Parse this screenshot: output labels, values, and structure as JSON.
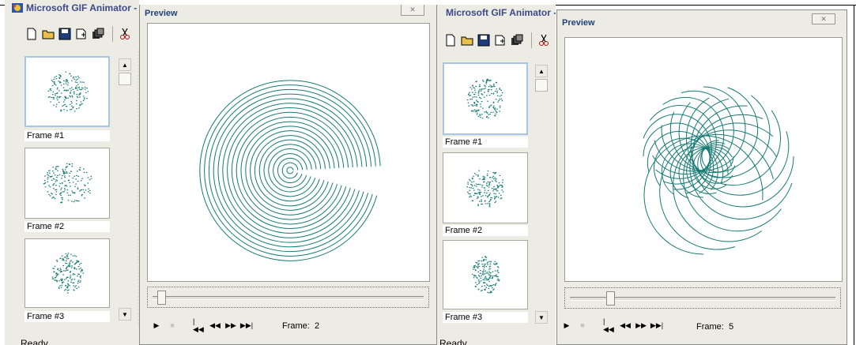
{
  "left_app": {
    "title": "Microsoft GIF Animator -",
    "frames": [
      {
        "label": "Frame #1",
        "selected": true
      },
      {
        "label": "Frame #2",
        "selected": false
      },
      {
        "label": "Frame #3",
        "selected": false
      }
    ],
    "status": "Ready"
  },
  "left_preview": {
    "title": "Preview",
    "close": "✕",
    "frame_label": "Frame:",
    "frame_value": "2"
  },
  "right_app": {
    "title": "Microsoft GIF Animator -",
    "frames": [
      {
        "label": "Frame #1",
        "selected": true
      },
      {
        "label": "Frame #2",
        "selected": false
      },
      {
        "label": "Frame #3",
        "selected": false
      }
    ],
    "status": "Ready"
  },
  "right_preview": {
    "title": "Preview",
    "close": "✕",
    "frame_label": "Frame:",
    "frame_value": "5"
  },
  "toolbar_icons": [
    "new-file-icon",
    "open-folder-icon",
    "save-icon",
    "insert-icon",
    "properties-icon",
    "cut-icon"
  ],
  "controls": [
    "play-icon",
    "stop-icon",
    "first-frame-icon",
    "previous-frame-icon",
    "next-frame-icon",
    "last-frame-icon"
  ],
  "colors": {
    "drawing": "#167a74",
    "window_bg": "#ecebe4",
    "title_text": "#23427a",
    "selection": "#a8c6e4"
  }
}
